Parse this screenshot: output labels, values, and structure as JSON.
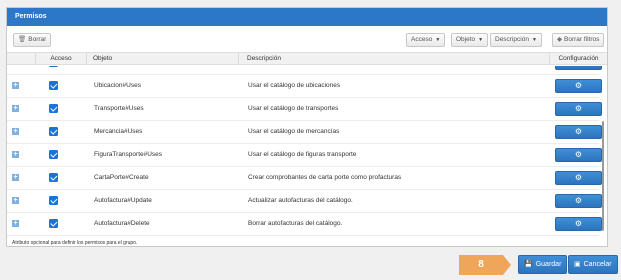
{
  "panel": {
    "title": "Permisos"
  },
  "toolbar": {
    "delete_label": "Borrar",
    "filter_acceso": "Acceso",
    "filter_objeto": "Objeto",
    "filter_descripcion": "Descripción",
    "clear_filters_label": "Borrar filtros"
  },
  "columns": {
    "acceso": "Acceso",
    "objeto": "Objeto",
    "descripcion": "Descripción",
    "configuracion": "Configuración"
  },
  "rows": [
    {
      "objeto": "Ubicacion#Uses",
      "descripcion": "Usar el catálogo de ubicaciones",
      "checked": true
    },
    {
      "objeto": "Transporte#Uses",
      "descripcion": "Usar el catálogo de transportes",
      "checked": true
    },
    {
      "objeto": "Mercancia#Uses",
      "descripcion": "Usar el catálogo de mercancías",
      "checked": true
    },
    {
      "objeto": "FiguraTransporte#Uses",
      "descripcion": "Usar el catálogo de figuras transporte",
      "checked": true
    },
    {
      "objeto": "CartaPorte#Create",
      "descripcion": "Crear comprobantes de carta porte como profacturas",
      "checked": true
    },
    {
      "objeto": "Autofactura#Update",
      "descripcion": "Actualizar autofacturas del catálogo.",
      "checked": true
    },
    {
      "objeto": "Autofactura#Delete",
      "descripcion": "Borrar autofacturas del catálogo.",
      "checked": true
    }
  ],
  "footnote": "Atributo opcional para definir los permisos para el grupo.",
  "step_marker": "8",
  "actions": {
    "save_label": "Guardar",
    "cancel_label": "Cancelar"
  },
  "colors": {
    "accent": "#2b78c9",
    "marker": "#f0a65a"
  },
  "icons": {
    "expand": "plus-icon",
    "config": "gear-icon",
    "save": "floppy-icon",
    "cancel": "close-doc-icon"
  }
}
